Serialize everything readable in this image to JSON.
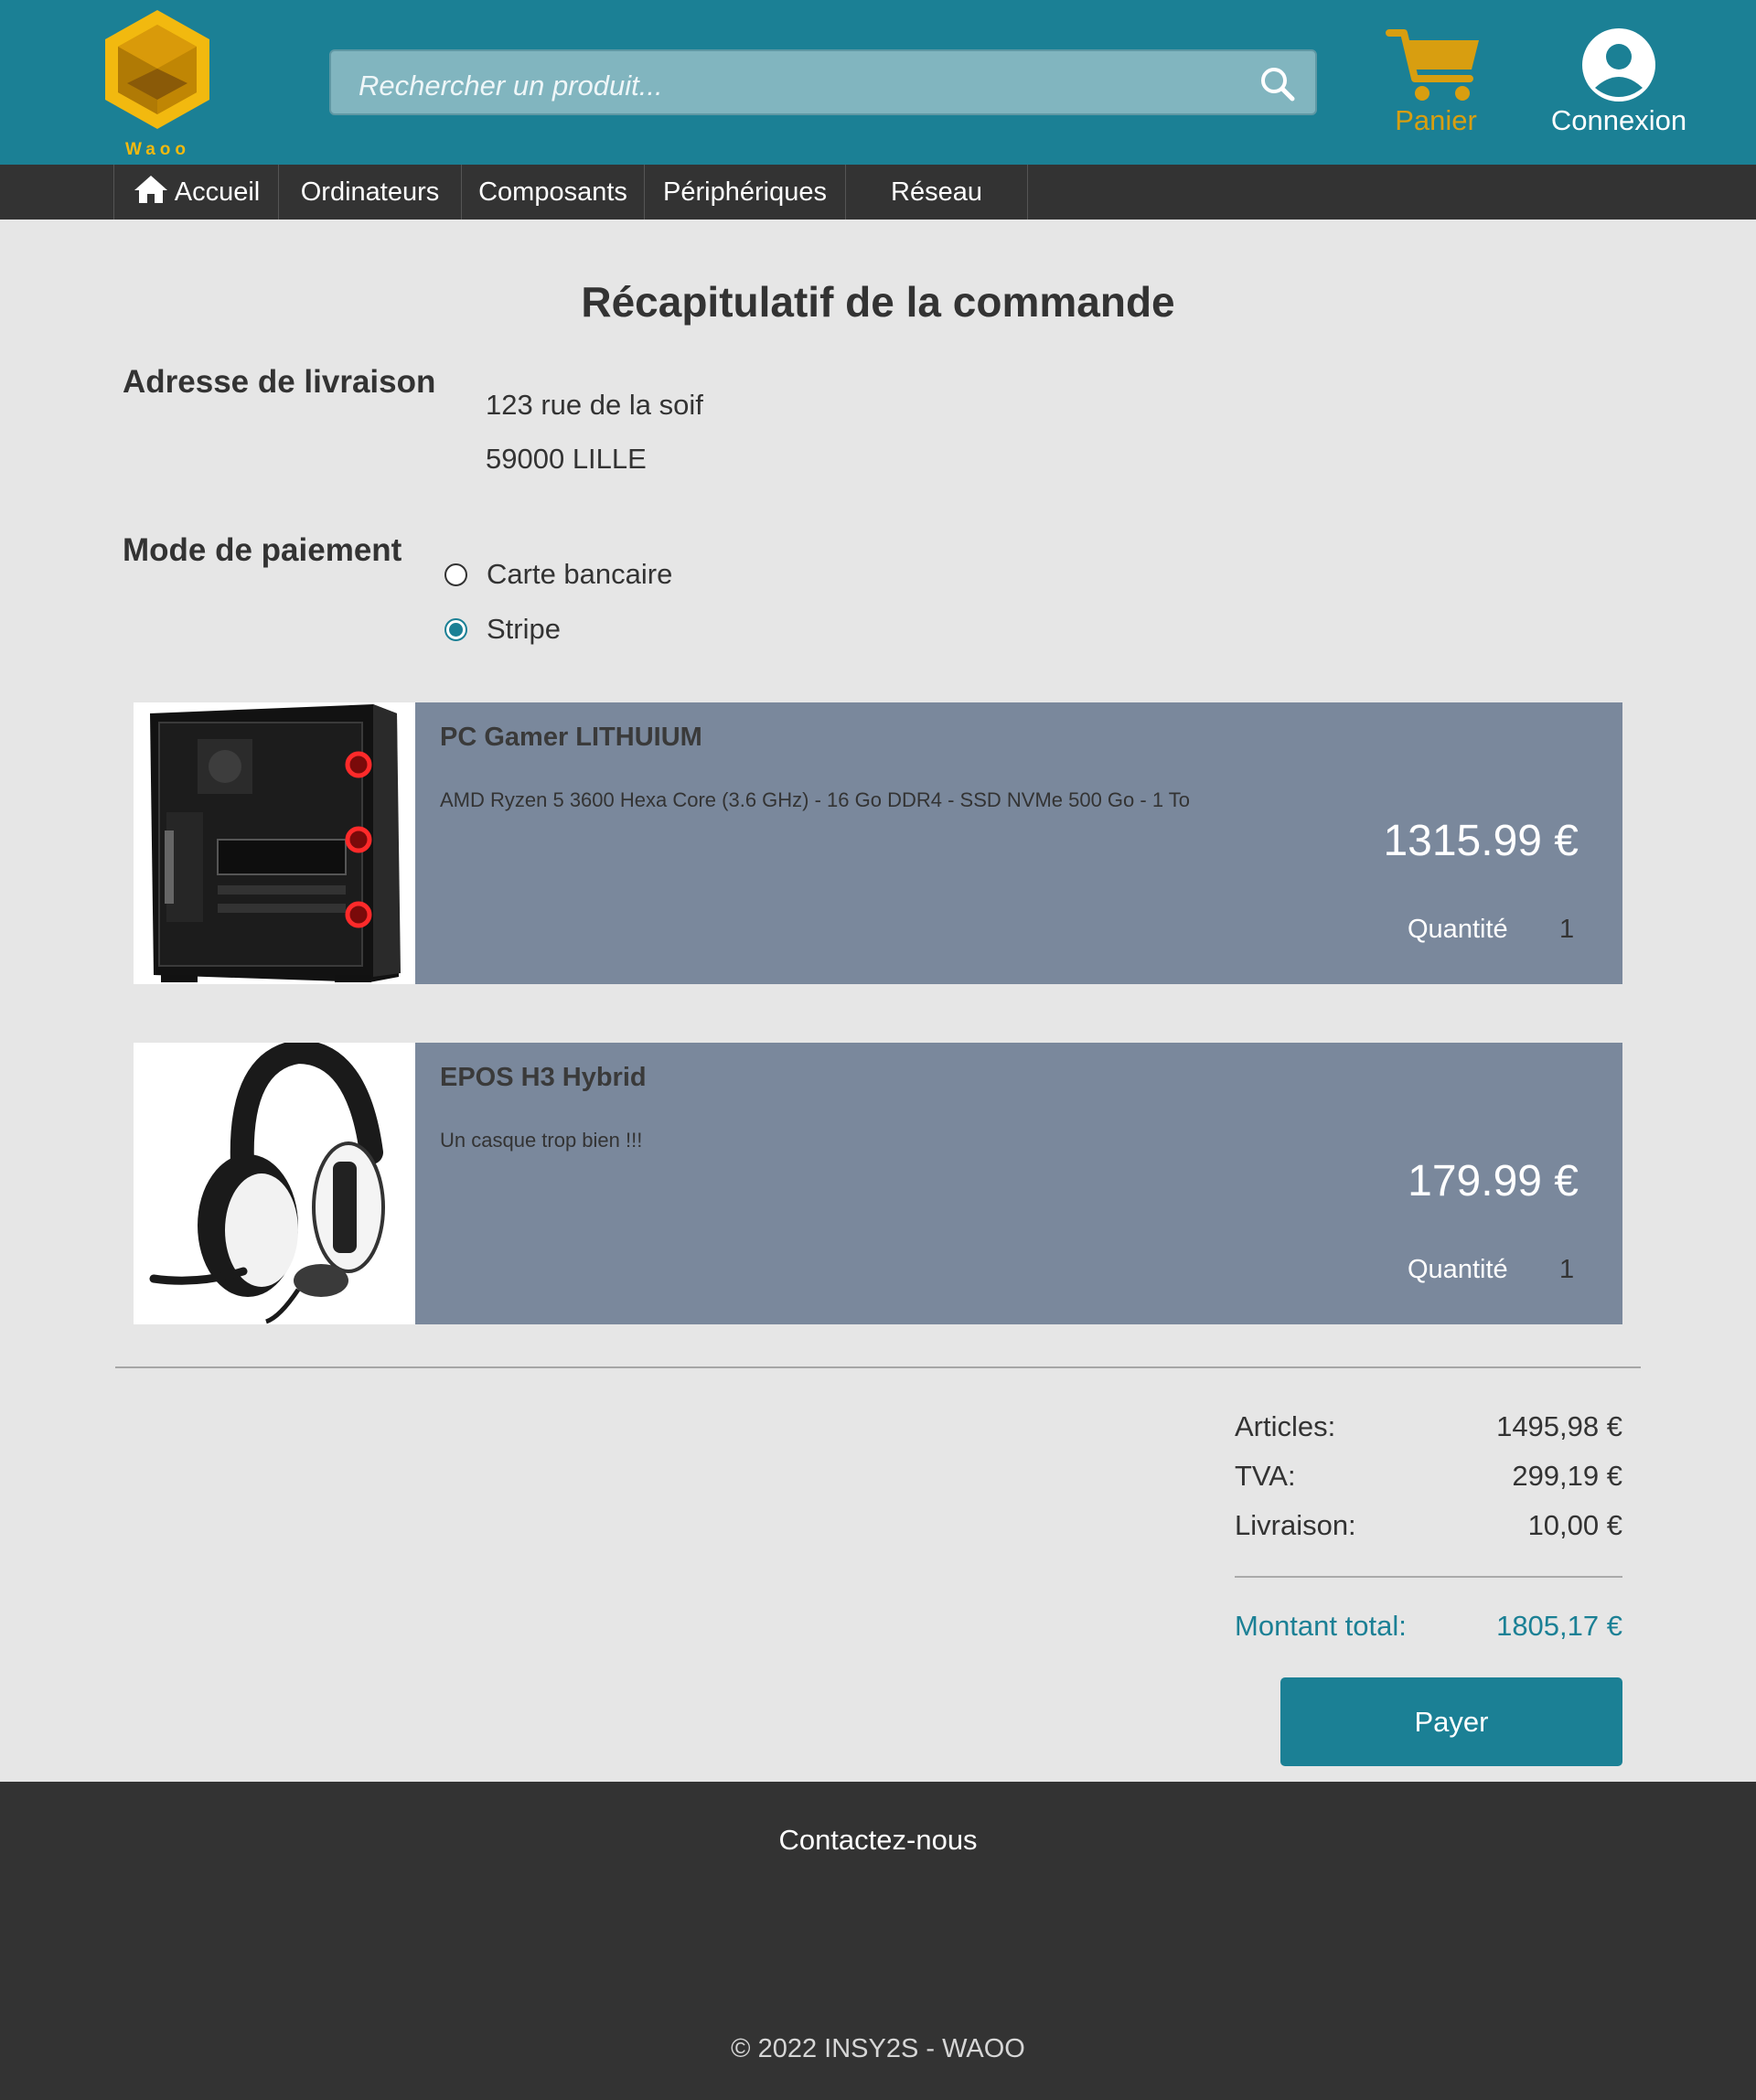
{
  "header": {
    "logo_text": "Waoo",
    "search_placeholder": "Rechercher un produit...",
    "cart_label": "Panier",
    "account_label": "Connexion",
    "brand_color": "#1b8095",
    "accent_color": "#f2b90f"
  },
  "nav": {
    "items": [
      {
        "label": "Accueil",
        "icon": "home-icon"
      },
      {
        "label": "Ordinateurs"
      },
      {
        "label": "Composants"
      },
      {
        "label": "Périphériques"
      },
      {
        "label": "Réseau"
      }
    ]
  },
  "main": {
    "title": "Récapitulatif de la commande",
    "address": {
      "label": "Adresse de livraison",
      "line1": "123 rue de la soif",
      "line2": "59000 LILLE"
    },
    "payment": {
      "label": "Mode de paiement",
      "options": [
        {
          "label": "Carte bancaire",
          "selected": false
        },
        {
          "label": "Stripe",
          "selected": true
        }
      ]
    },
    "products": [
      {
        "name": "PC Gamer LITHUIUM",
        "description": "AMD Ryzen 5 3600 Hexa Core (3.6 GHz) - 16 Go DDR4 - SSD NVMe 500 Go - 1 To",
        "price": "1315.99 €",
        "quantity_label": "Quantité",
        "quantity": "1",
        "image": "pc-case-image"
      },
      {
        "name": "EPOS H3 Hybrid",
        "description": "Un casque trop bien !!!",
        "price": "179.99 €",
        "quantity_label": "Quantité",
        "quantity": "1",
        "image": "headset-image"
      }
    ],
    "summary": {
      "articles_label": "Articles:",
      "articles_value": "1495,98 €",
      "tva_label": "TVA:",
      "tva_value": "299,19 €",
      "shipping_label": "Livraison:",
      "shipping_value": "10,00 €",
      "total_label": "Montant total:",
      "total_value": "1805,17 €"
    },
    "pay_button": "Payer"
  },
  "footer": {
    "contact": "Contactez-nous",
    "copyright": "© 2022 INSY2S - WAOO"
  }
}
